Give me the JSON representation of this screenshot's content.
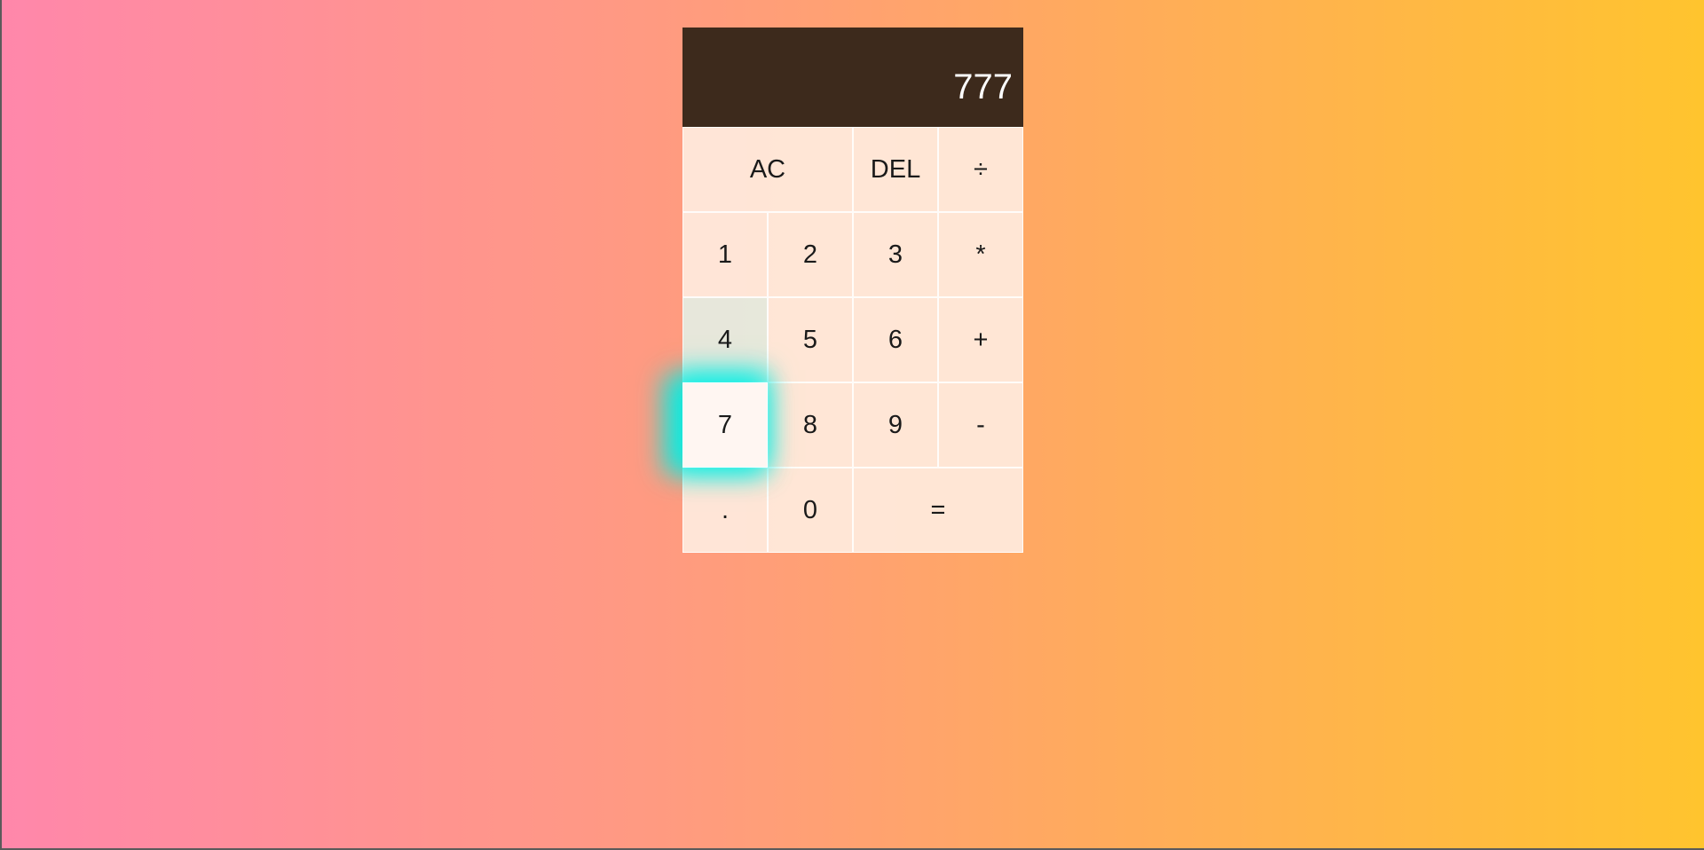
{
  "display": {
    "value": "777"
  },
  "keys": {
    "ac": "AC",
    "del": "DEL",
    "divide": "÷",
    "one": "1",
    "two": "2",
    "three": "3",
    "multiply": "*",
    "four": "4",
    "five": "5",
    "six": "6",
    "plus": "+",
    "seven": "7",
    "eight": "8",
    "nine": "9",
    "minus": "-",
    "decimal": ".",
    "zero": "0",
    "equals": "="
  },
  "colors": {
    "display_bg": "#3d2a1c",
    "key_bg": "#ffecde",
    "hover_glow": "#00eee4"
  }
}
